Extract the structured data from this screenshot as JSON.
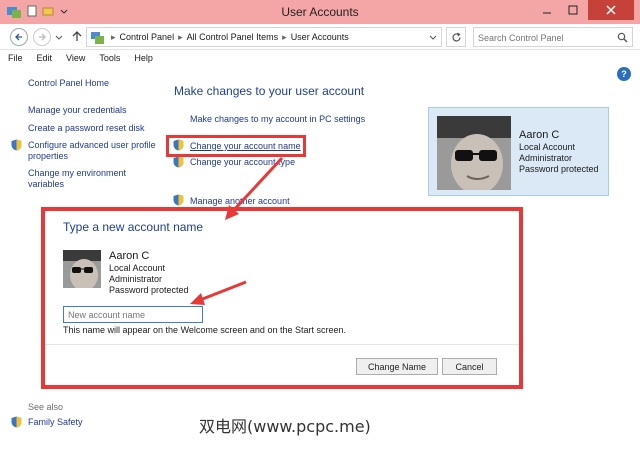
{
  "window": {
    "title": "User Accounts"
  },
  "address": {
    "crumbs": [
      "Control Panel",
      "All Control Panel Items",
      "User Accounts"
    ],
    "search_placeholder": "Search Control Panel"
  },
  "menu": [
    "File",
    "Edit",
    "View",
    "Tools",
    "Help"
  ],
  "left_nav": {
    "home": "Control Panel Home",
    "items": [
      "Manage your credentials",
      "Create a password reset disk",
      "Configure advanced user profile properties",
      "Change my environment variables"
    ],
    "see_also": "See also",
    "family_safety": "Family Safety"
  },
  "main": {
    "heading": "Make changes to your user account",
    "pc_settings_link": "Make changes to my account in PC settings",
    "change_name_link": "Change your account name",
    "change_type_link": "Change your account type",
    "manage_another": "Manage another account"
  },
  "account": {
    "name": "Aaron C",
    "type": "Local Account",
    "role": "Administrator",
    "protection": "Password protected"
  },
  "dialog": {
    "title": "Type a new account name",
    "input_placeholder": "New account name",
    "hint": "This name will appear on the Welcome screen and on the Start screen.",
    "change_button": "Change Name",
    "cancel_button": "Cancel"
  },
  "watermark": "双电网(www.pcpc.me)",
  "colors": {
    "titlebar": "#f4a6a6",
    "close": "#c7413b",
    "link": "#1f3a93",
    "heading": "#1e3f91",
    "annotation": "#e83838",
    "card": "#dbe9f7"
  }
}
